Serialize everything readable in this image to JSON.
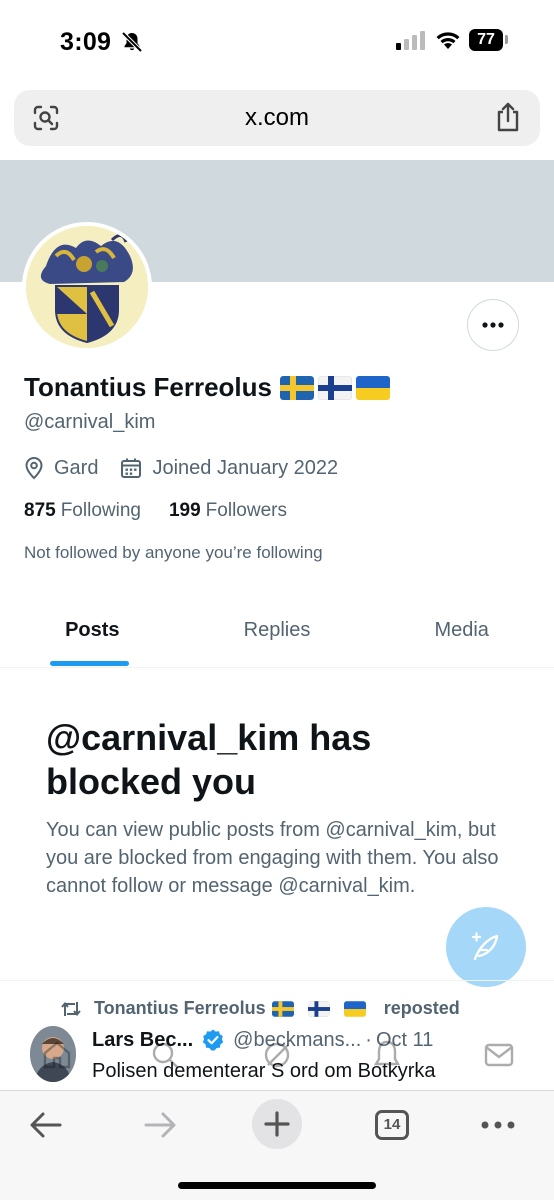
{
  "status_bar": {
    "time": "3:09",
    "battery": "77"
  },
  "browser": {
    "url": "x.com",
    "tab_count": "14"
  },
  "profile": {
    "display_name": "Tonantius Ferreolus",
    "flags": [
      "sweden",
      "finland",
      "ukraine"
    ],
    "handle": "@carnival_kim",
    "location": "Gard",
    "joined": "Joined January 2022",
    "following_count": "875",
    "following_label": "Following",
    "followers_count": "199",
    "followers_label": "Followers",
    "not_followed": "Not followed by anyone you’re following"
  },
  "tabs": [
    {
      "label": "Posts",
      "active": true
    },
    {
      "label": "Replies",
      "active": false
    },
    {
      "label": "Media",
      "active": false
    }
  ],
  "blocked": {
    "title": "@carnival_kim has blocked you",
    "body": "You can view public posts from @carnival_kim, but you are blocked from engaging with them. You also cannot follow or message @carnival_kim."
  },
  "timeline": {
    "repost_by": "Tonantius Ferreolus",
    "repost_label": "reposted",
    "author_name": "Lars Bec...",
    "author_handle": "@beckmans...",
    "separator": "·",
    "date": "Oct 11",
    "text": "Polisen dementerar S ord om Botkyrka"
  },
  "colors": {
    "accent": "#1d9bf0",
    "banner": "#cfd9de",
    "fab": "#a5d7f8"
  }
}
